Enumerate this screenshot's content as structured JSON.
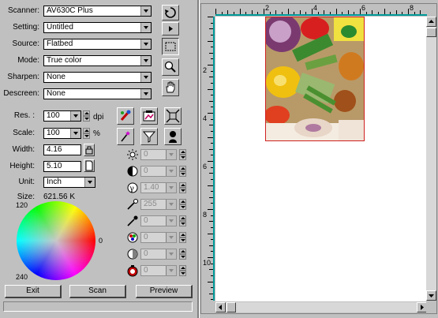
{
  "settings": {
    "scanner_label": "Scanner:",
    "scanner_value": "AV630C Plus",
    "setting_label": "Setting:",
    "setting_value": "Untitled",
    "source_label": "Source:",
    "source_value": "Flatbed",
    "mode_label": "Mode:",
    "mode_value": "True color",
    "sharpen_label": "Sharpen:",
    "sharpen_value": "None",
    "descreen_label": "Descreen:",
    "descreen_value": "None"
  },
  "resolution": {
    "res_label": "Res. :",
    "res_value": "100",
    "res_unit": "dpi",
    "scale_label": "Scale:",
    "scale_value": "100",
    "scale_unit": "%",
    "width_label": "Width:",
    "width_value": "4.16",
    "height_label": "Height:",
    "height_value": "5.10",
    "unit_label": "Unit:",
    "unit_value": "Inch",
    "size_label": "Size:",
    "size_value": "621.56 K"
  },
  "color_wheel": {
    "label_top": "120",
    "label_right": "0",
    "label_bottom": "240"
  },
  "adjustments": {
    "brightness": "0",
    "contrast": "0",
    "gamma": "1.40",
    "highlight": "255",
    "shadow": "0",
    "hue": "0",
    "saturation": "0",
    "color_balance": "0"
  },
  "buttons": {
    "exit": "Exit",
    "scan": "Scan",
    "preview": "Preview"
  },
  "ruler": {
    "h_numbers": [
      "2",
      "4",
      "6",
      "8"
    ],
    "v_numbers": [
      "2",
      "4",
      "6",
      "8",
      "10"
    ]
  },
  "colors": {
    "ruler_accent": "#009a9a",
    "selection_border": "#d02020"
  }
}
